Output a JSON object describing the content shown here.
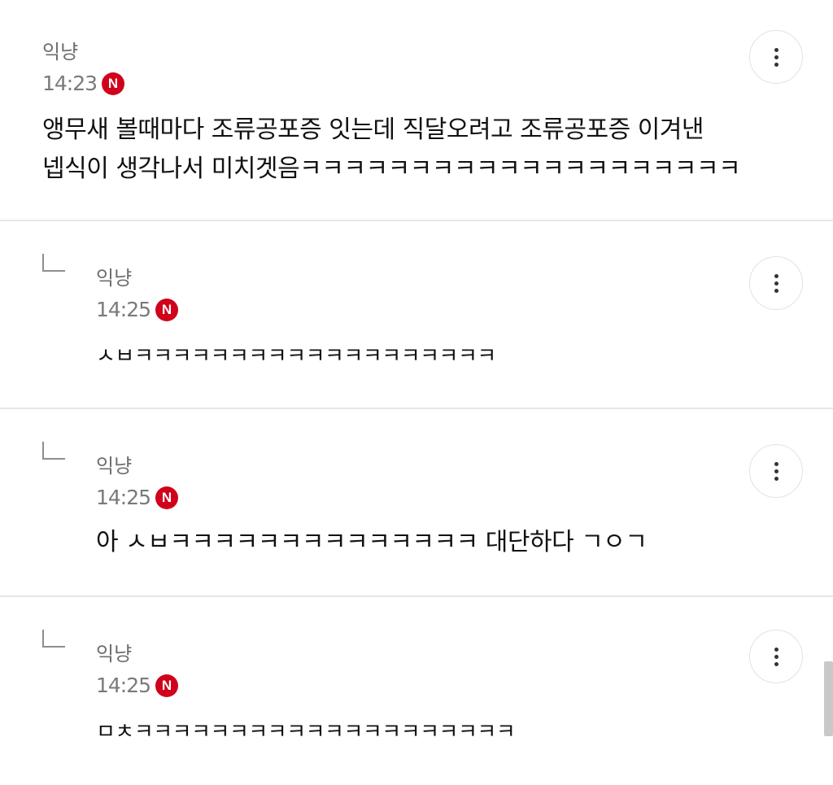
{
  "comments": [
    {
      "author": "익냥",
      "time": "14:23",
      "badge": "N",
      "line1": "앵무새 볼때마다 조류공포증 잇는데 직달오려고 조류공포증 이겨낸",
      "line2": "넵식이 생각나서 미치겟음ㅋㅋㅋㅋㅋㅋㅋㅋㅋㅋㅋㅋㅋㅋㅋㅋㅋㅋㅋㅋ"
    },
    {
      "author": "익냥",
      "time": "14:25",
      "badge": "N",
      "text": "ㅅㅂㅋㅋㅋㅋㅋㅋㅋㅋㅋㅋㅋㅋㅋㅋㅋㅋㅋㅋㅋ"
    },
    {
      "author": "익냥",
      "time": "14:25",
      "badge": "N",
      "text": "아 ㅅㅂㅋㅋㅋㅋㅋㅋㅋㅋㅋㅋㅋㅋㅋㅋ 대단하다 ㄱㅇㄱ"
    },
    {
      "author": "익냥",
      "time": "14:25",
      "badge": "N",
      "text": "ㅁㅊㅋㅋㅋㅋㅋㅋㅋㅋㅋㅋㅋㅋㅋㅋㅋㅋㅋㅋㅋㅋ"
    }
  ],
  "icons": {
    "more": "more-vertical-icon",
    "reply": "reply-arrow-icon",
    "new": "new-badge-icon"
  },
  "colors": {
    "badge": "#d0021b",
    "divider": "#e6e6e6",
    "meta_text": "#7a7a7a",
    "body_text": "#111111"
  }
}
